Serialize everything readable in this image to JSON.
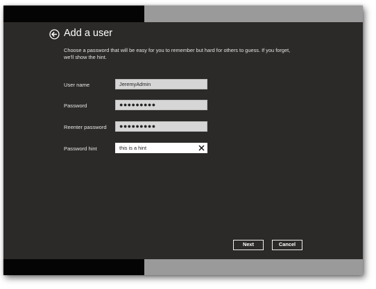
{
  "header": {
    "title": "Add a user",
    "back_icon": "back-arrow-circle-icon"
  },
  "instructions": "Choose a password that will be easy for you to remember but hard for others to guess. If you forget, we'll show the hint.",
  "fields": {
    "username": {
      "label": "User name",
      "value": "JeremyAdmin"
    },
    "password": {
      "label": "Password",
      "value": "●●●●●●●●●"
    },
    "reenter": {
      "label": "Reenter password",
      "value": "●●●●●●●●●"
    },
    "hint": {
      "label": "Password hint",
      "value": "this is a hint",
      "clear_icon": "close-x-icon"
    }
  },
  "buttons": {
    "next": "Next",
    "cancel": "Cancel"
  },
  "colors": {
    "background": "#2b2a28",
    "text": "#ffffff",
    "field": "#d6d6d6",
    "field_active": "#ffffff"
  }
}
